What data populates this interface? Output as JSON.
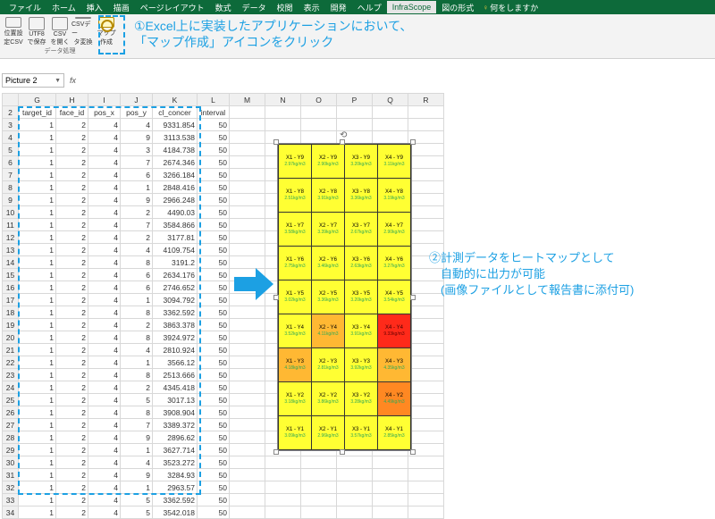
{
  "ribbon_tabs": [
    "ファイル",
    "ホーム",
    "挿入",
    "描画",
    "ページレイアウト",
    "数式",
    "データ",
    "校閲",
    "表示",
    "開発",
    "ヘルプ",
    "InfraScope",
    "図の形式"
  ],
  "tellme": "何をしますか",
  "active_tab": "InfraScope",
  "rib": {
    "b1": {
      "l1": "位置設",
      "l2": "定CSV"
    },
    "b2": {
      "l1": "UTF8",
      "l2": "で保存"
    },
    "b3": {
      "l1": "CSV",
      "l2": "を開く"
    },
    "b4": {
      "l1": "CSVデー",
      "l2": "タ変換"
    },
    "b5": {
      "l1": "マップ",
      "l2": "作成"
    },
    "group": "データ処理"
  },
  "anno1_l1": "①Excel上に実装したアプリケーションにおいて、",
  "anno1_l2": "「マップ作成」アイコンをクリック",
  "anno2_l1": "②計測データをヒートマップとして",
  "anno2_l2": "　自動的に出力が可能",
  "anno2_l3": "　(画像ファイルとして報告書に添付可)",
  "namebox": "Picture 2",
  "fx": "fx",
  "cols": [
    "",
    "G",
    "H",
    "I",
    "J",
    "K",
    "L",
    "M",
    "N",
    "O",
    "P",
    "Q",
    "R"
  ],
  "headers": [
    "target_id",
    "face_id",
    "pos_x",
    "pos_y",
    "cl_concer",
    "interval"
  ],
  "rows": [
    {
      "r": 3,
      "d": [
        1,
        2,
        4,
        4,
        "9331.854",
        50
      ]
    },
    {
      "r": 4,
      "d": [
        1,
        2,
        4,
        9,
        "3113.538",
        50
      ]
    },
    {
      "r": 5,
      "d": [
        1,
        2,
        4,
        3,
        "4184.738",
        50
      ]
    },
    {
      "r": 6,
      "d": [
        1,
        2,
        4,
        7,
        "2674.346",
        50
      ]
    },
    {
      "r": 7,
      "d": [
        1,
        2,
        4,
        6,
        "3266.184",
        50
      ]
    },
    {
      "r": 8,
      "d": [
        1,
        2,
        4,
        1,
        "2848.416",
        50
      ]
    },
    {
      "r": 9,
      "d": [
        1,
        2,
        4,
        9,
        "2966.248",
        50
      ]
    },
    {
      "r": 10,
      "d": [
        1,
        2,
        4,
        2,
        "4490.03",
        50
      ]
    },
    {
      "r": 11,
      "d": [
        1,
        2,
        4,
        7,
        "3584.866",
        50
      ]
    },
    {
      "r": 12,
      "d": [
        1,
        2,
        4,
        2,
        "3177.81",
        50
      ]
    },
    {
      "r": 13,
      "d": [
        1,
        2,
        4,
        4,
        "4109.754",
        50
      ]
    },
    {
      "r": 14,
      "d": [
        1,
        2,
        4,
        8,
        "3191.2",
        50
      ]
    },
    {
      "r": 15,
      "d": [
        1,
        2,
        4,
        6,
        "2634.176",
        50
      ]
    },
    {
      "r": 16,
      "d": [
        1,
        2,
        4,
        6,
        "2746.652",
        50
      ]
    },
    {
      "r": 17,
      "d": [
        1,
        2,
        4,
        1,
        "3094.792",
        50
      ]
    },
    {
      "r": 18,
      "d": [
        1,
        2,
        4,
        8,
        "3362.592",
        50
      ]
    },
    {
      "r": 19,
      "d": [
        1,
        2,
        4,
        2,
        "3863.378",
        50
      ]
    },
    {
      "r": 20,
      "d": [
        1,
        2,
        4,
        8,
        "3924.972",
        50
      ]
    },
    {
      "r": 21,
      "d": [
        1,
        2,
        4,
        4,
        "2810.924",
        50
      ]
    },
    {
      "r": 22,
      "d": [
        1,
        2,
        4,
        1,
        "3566.12",
        50
      ]
    },
    {
      "r": 23,
      "d": [
        1,
        2,
        4,
        8,
        "2513.666",
        50
      ]
    },
    {
      "r": 24,
      "d": [
        1,
        2,
        4,
        2,
        "4345.418",
        50
      ]
    },
    {
      "r": 25,
      "d": [
        1,
        2,
        4,
        5,
        "3017.13",
        50
      ]
    },
    {
      "r": 26,
      "d": [
        1,
        2,
        4,
        8,
        "3908.904",
        50
      ]
    },
    {
      "r": 27,
      "d": [
        1,
        2,
        4,
        7,
        "3389.372",
        50
      ]
    },
    {
      "r": 28,
      "d": [
        1,
        2,
        4,
        9,
        "2896.62",
        50
      ]
    },
    {
      "r": 29,
      "d": [
        1,
        2,
        4,
        1,
        "3627.714",
        50
      ]
    },
    {
      "r": 30,
      "d": [
        1,
        2,
        4,
        4,
        "3523.272",
        50
      ]
    },
    {
      "r": 31,
      "d": [
        1,
        2,
        4,
        9,
        "3284.93",
        50
      ]
    },
    {
      "r": 32,
      "d": [
        1,
        2,
        4,
        1,
        "2963.57",
        50
      ]
    },
    {
      "r": 33,
      "d": [
        1,
        2,
        4,
        5,
        "3362.592",
        50
      ]
    },
    {
      "r": 34,
      "d": [
        1,
        2,
        4,
        5,
        "3542.018",
        50
      ]
    }
  ],
  "heatmap": [
    [
      {
        "c": "y",
        "l": "X1 - Y9",
        "v": "2.97kg/m3"
      },
      {
        "c": "y",
        "l": "X2 - Y9",
        "v": "2.90kg/m3"
      },
      {
        "c": "y",
        "l": "X3 - Y9",
        "v": "3.20kg/m3"
      },
      {
        "c": "y",
        "l": "X4 - Y9",
        "v": "3.11kg/m3"
      }
    ],
    [
      {
        "c": "y",
        "l": "X1 - Y8",
        "v": "2.51kg/m3"
      },
      {
        "c": "y",
        "l": "X2 - Y8",
        "v": "3.91kg/m3"
      },
      {
        "c": "y",
        "l": "X3 - Y8",
        "v": "3.36kg/m3"
      },
      {
        "c": "y",
        "l": "X4 - Y8",
        "v": "3.19kg/m3"
      }
    ],
    [
      {
        "c": "y",
        "l": "X1 - Y7",
        "v": "3.58kg/m3"
      },
      {
        "c": "y",
        "l": "X2 - Y7",
        "v": "3.39kg/m3"
      },
      {
        "c": "y",
        "l": "X3 - Y7",
        "v": "2.67kg/m3"
      },
      {
        "c": "y",
        "l": "X4 - Y7",
        "v": "2.90kg/m3"
      }
    ],
    [
      {
        "c": "y",
        "l": "X1 - Y6",
        "v": "2.75kg/m3"
      },
      {
        "c": "y",
        "l": "X2 - Y6",
        "v": "3.46kg/m3"
      },
      {
        "c": "y",
        "l": "X3 - Y6",
        "v": "2.63kg/m3"
      },
      {
        "c": "y",
        "l": "X4 - Y6",
        "v": "3.27kg/m3"
      }
    ],
    [
      {
        "c": "y",
        "l": "X1 - Y5",
        "v": "3.02kg/m3"
      },
      {
        "c": "y",
        "l": "X2 - Y5",
        "v": "3.36kg/m3"
      },
      {
        "c": "y",
        "l": "X3 - Y5",
        "v": "3.20kg/m3"
      },
      {
        "c": "y",
        "l": "X4 - Y5",
        "v": "3.54kg/m3"
      }
    ],
    [
      {
        "c": "y",
        "l": "X1 - Y4",
        "v": "3.52kg/m3"
      },
      {
        "c": "o1",
        "l": "X2 - Y4",
        "v": "4.11kg/m3"
      },
      {
        "c": "y",
        "l": "X3 - Y4",
        "v": "3.91kg/m3"
      },
      {
        "c": "r",
        "l": "X4 - Y4",
        "v": "9.33kg/m3"
      }
    ],
    [
      {
        "c": "o1",
        "l": "X1 - Y3",
        "v": "4.18kg/m3"
      },
      {
        "c": "y",
        "l": "X2 - Y3",
        "v": "2.81kg/m3"
      },
      {
        "c": "y",
        "l": "X3 - Y3",
        "v": "3.92kg/m3"
      },
      {
        "c": "o1",
        "l": "X4 - Y3",
        "v": "4.35kg/m3"
      }
    ],
    [
      {
        "c": "y",
        "l": "X1 - Y2",
        "v": "3.18kg/m3"
      },
      {
        "c": "y",
        "l": "X2 - Y2",
        "v": "3.86kg/m3"
      },
      {
        "c": "y",
        "l": "X3 - Y2",
        "v": "3.28kg/m3"
      },
      {
        "c": "o2",
        "l": "X4 - Y2",
        "v": "4.49kg/m3"
      }
    ],
    [
      {
        "c": "y",
        "l": "X1 - Y1",
        "v": "3.09kg/m3"
      },
      {
        "c": "y",
        "l": "X2 - Y1",
        "v": "2.96kg/m3"
      },
      {
        "c": "y",
        "l": "X3 - Y1",
        "v": "3.57kg/m3"
      },
      {
        "c": "y",
        "l": "X4 - Y1",
        "v": "2.85kg/m3"
      }
    ]
  ]
}
